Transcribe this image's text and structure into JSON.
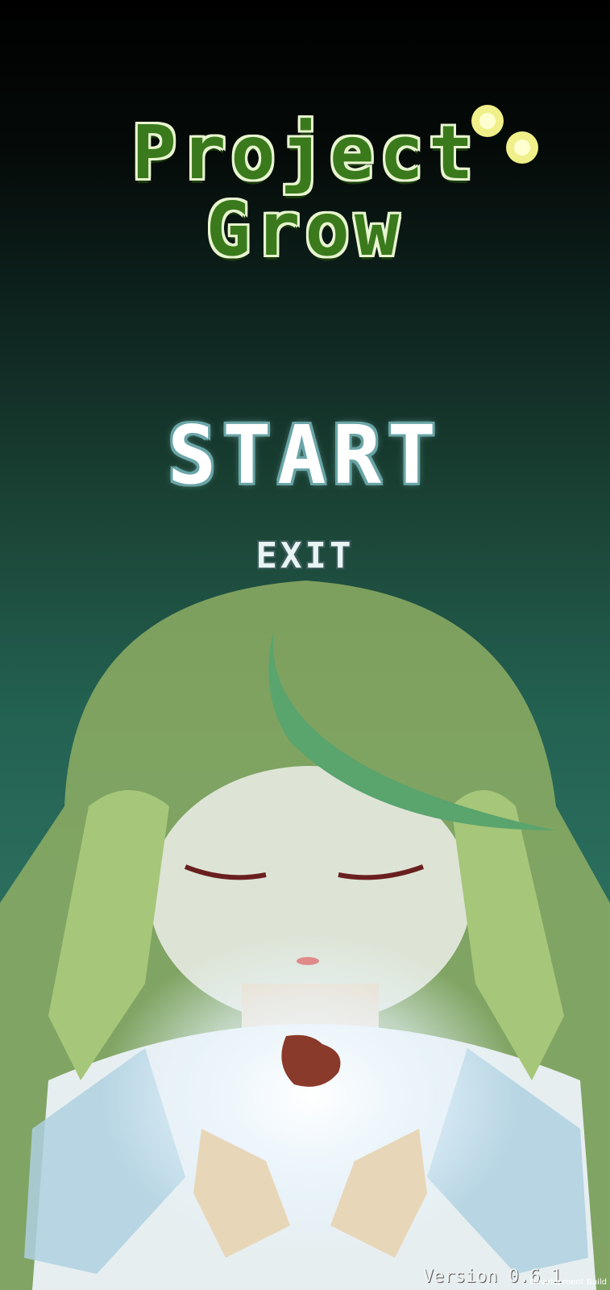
{
  "title": {
    "line1": "Project",
    "line2": "Grow"
  },
  "menu": {
    "start_label": "START",
    "exit_label": "EXIT"
  },
  "footer": {
    "version": "Version 0.6.1",
    "build": "Development Build"
  },
  "colors": {
    "title_fill": "#3a7a1c",
    "title_outline": "#e8f5d0",
    "sparkle": "#f0f08a",
    "menu_text": "#ffffff",
    "hair": "#a8c47a",
    "leaf": "#5aa46e",
    "seed": "#8a3a2a"
  },
  "icons": {
    "sparkle": "sparkle-icon",
    "seed": "seed-icon",
    "leaf": "leaf-icon"
  }
}
